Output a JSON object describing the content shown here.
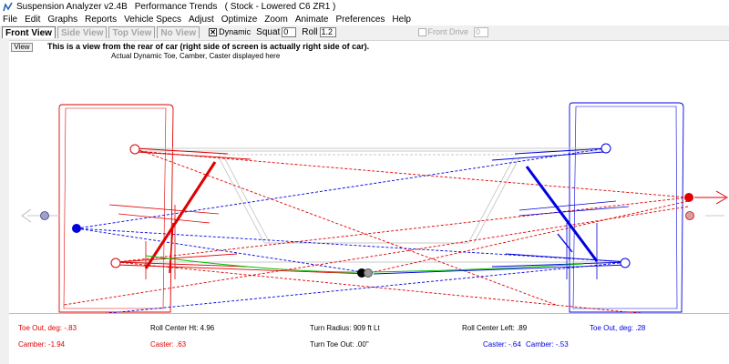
{
  "titlebar": {
    "app_name": "Suspension Analyzer v2.4B",
    "document": "Performance Trends   ( Stock - Lowered C6 ZR1 )"
  },
  "menu": [
    "File",
    "Edit",
    "Graphs",
    "Reports",
    "Vehicle Specs",
    "Adjust",
    "Optimize",
    "Zoom",
    "Animate",
    "Preferences",
    "Help"
  ],
  "toolbar": {
    "tabs": [
      "Front View",
      "Side View",
      "Top View",
      "No View"
    ],
    "dynamic_label": "Dynamic",
    "dynamic_checked": true,
    "squat_label": "Squat",
    "squat_value": "0",
    "roll_label": "Roll",
    "roll_value": "1.2",
    "front_drive_label": "Front Drive",
    "front_drive_checked": false,
    "front_drive_value": "0"
  },
  "canvas": {
    "view_button": "View",
    "heading": "This is a view from the rear of car (right side of screen is actually right side of car).",
    "subheading": "Actual Dynamic Toe, Camber, Caster displayed here"
  },
  "readouts": {
    "left_toe": "Toe Out, deg: -.83",
    "left_camber": "Camber: -1.94",
    "roll_center_ht": "Roll Center Ht: 4.96",
    "left_caster": "Caster: .63",
    "turn_radius": "Turn Radius: 909 ft Lt",
    "turn_toe_out": "Turn Toe Out: .00\"",
    "roll_center_left": "Roll Center Left: .89",
    "right_caster": "Caster: -.64",
    "right_toe": "Toe Out, deg: .28",
    "right_camber": "Camber: -.53"
  },
  "colors": {
    "left_side": "#e00000",
    "right_side": "#0000e0",
    "roll_center": "#00c000",
    "reference": "#c8c8c8"
  },
  "icons": [
    "suspension-app-icon",
    "check-icon",
    "left-arrow-icon",
    "right-arrow-icon"
  ]
}
